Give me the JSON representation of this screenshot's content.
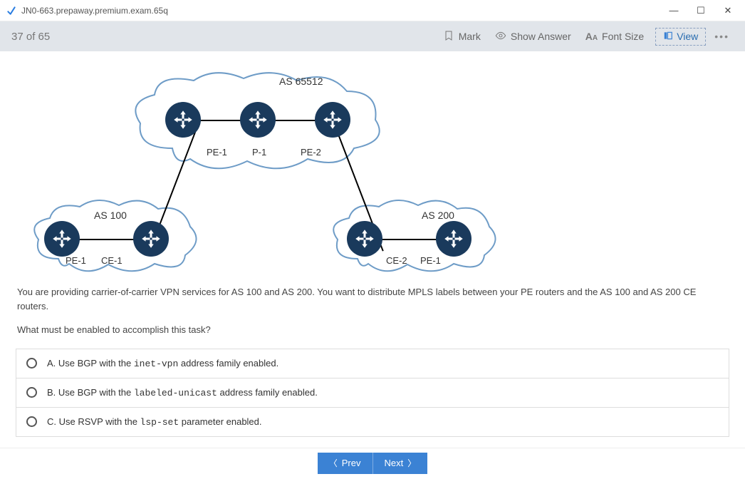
{
  "window": {
    "title": "JN0-663.prepaway.premium.exam.65q"
  },
  "toolbar": {
    "progress": "37 of 65",
    "mark": "Mark",
    "show_answer": "Show Answer",
    "font_size": "Font Size",
    "view": "View"
  },
  "diagram": {
    "clouds": {
      "top": "AS 65512",
      "left": "AS 100",
      "right": "AS 200"
    },
    "routers": {
      "top_left": "PE-1",
      "top_mid": "P-1",
      "top_right": "PE-2",
      "bl_outer": "PE-1",
      "bl_inner": "CE-1",
      "br_inner": "CE-2",
      "br_outer": "PE-1"
    }
  },
  "question": {
    "body": "You are providing carrier-of-carrier VPN services for AS 100 and AS 200. You want to distribute MPLS labels between your PE routers and the AS 100 and AS 200 CE routers.",
    "prompt": "What must be enabled to accomplish this task?"
  },
  "options": {
    "a_pre": "A.  Use BGP with the ",
    "a_code": "inet-vpn",
    "a_post": " address family enabled.",
    "b_pre": "B.  Use BGP with the ",
    "b_code": "labeled-unicast",
    "b_post": " address family enabled.",
    "c_pre": "C.  Use RSVP with the ",
    "c_code": "lsp-set",
    "c_post": " parameter enabled."
  },
  "nav": {
    "prev": "Prev",
    "next": "Next"
  }
}
